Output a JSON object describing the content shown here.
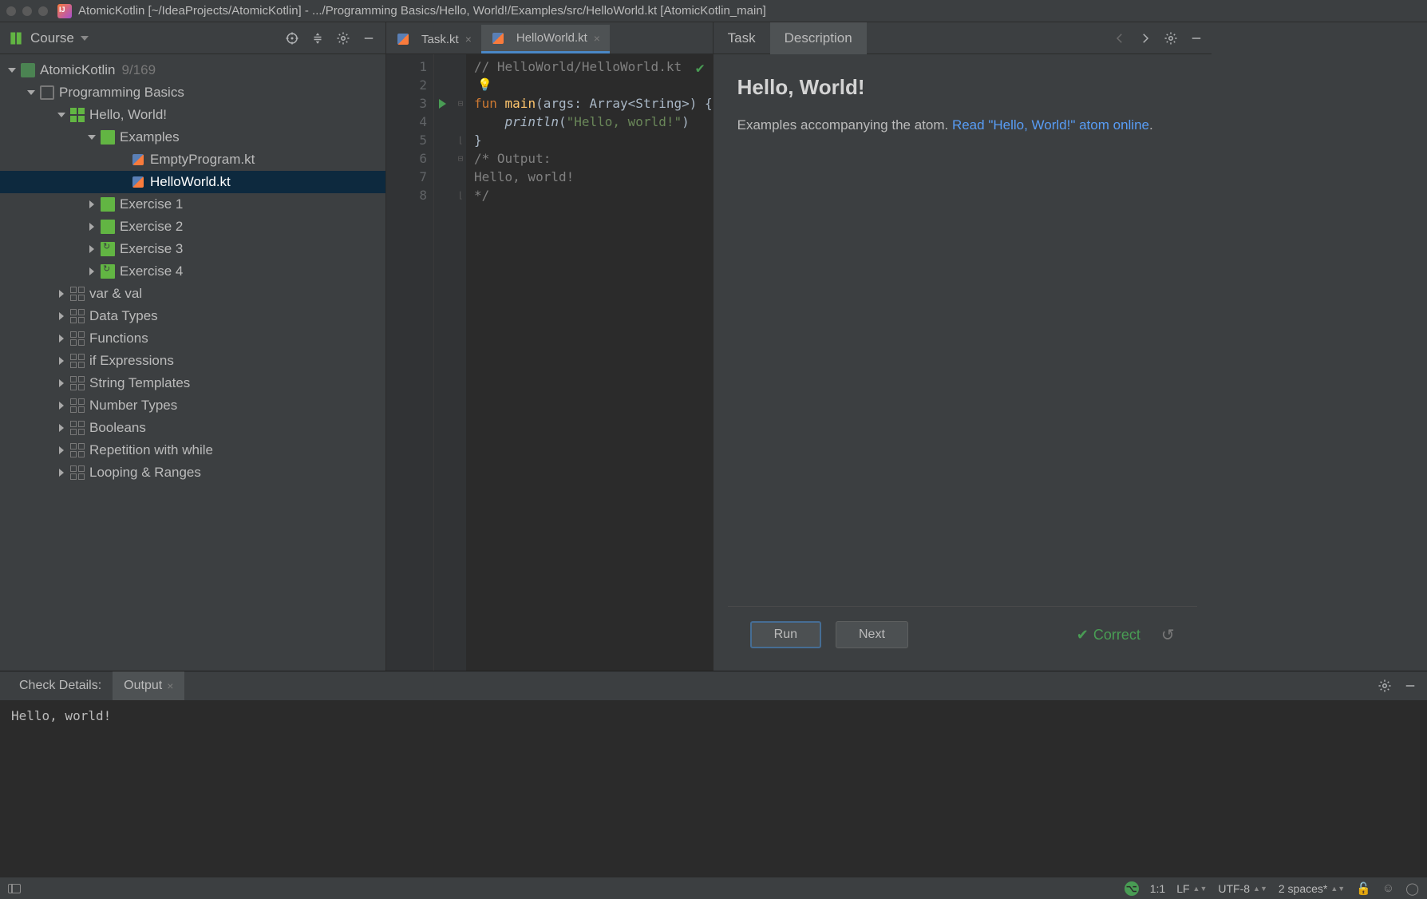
{
  "titlebar": "AtomicKotlin [~/IdeaProjects/AtomicKotlin] - .../Programming Basics/Hello, World!/Examples/src/HelloWorld.kt [AtomicKotlin_main]",
  "sidebar": {
    "header_label": "Course",
    "root": {
      "label": "AtomicKotlin",
      "count": "9/169"
    },
    "module": "Programming Basics",
    "lesson_current": "Hello, World!",
    "examples_label": "Examples",
    "files": [
      "EmptyProgram.kt",
      "HelloWorld.kt"
    ],
    "exercises": [
      "Exercise 1",
      "Exercise 2",
      "Exercise 3",
      "Exercise 4"
    ],
    "lessons": [
      "var & val",
      "Data Types",
      "Functions",
      "if Expressions",
      "String Templates",
      "Number Types",
      "Booleans",
      "Repetition with while",
      "Looping & Ranges"
    ]
  },
  "editor": {
    "tabs": [
      {
        "label": "Task.kt",
        "active": false
      },
      {
        "label": "HelloWorld.kt",
        "active": true
      }
    ],
    "line_numbers": [
      "1",
      "2",
      "3",
      "4",
      "5",
      "6",
      "7",
      "8"
    ],
    "code": {
      "l1_comment": "// HelloWorld/HelloWorld.kt",
      "l3_fun": "fun",
      "l3_main": " main",
      "l3_sig": "(args: Array<String>) {",
      "l4_fn": "println",
      "l4_open": "(",
      "l4_str": "\"Hello, world!\"",
      "l4_close": ")",
      "l5": "}",
      "l6": "/* Output:",
      "l7": "Hello, world!",
      "l8": "*/"
    }
  },
  "task": {
    "tabs": [
      "Task",
      "Description"
    ],
    "title": "Hello, World!",
    "body_prefix": "Examples accompanying the atom. ",
    "body_link": "Read \"Hello, World!\" atom online",
    "body_suffix": ".",
    "run_label": "Run",
    "next_label": "Next",
    "status": "Correct"
  },
  "bottom": {
    "tabs": [
      "Check Details:",
      "Output"
    ],
    "output": "Hello, world!"
  },
  "status": {
    "pos": "1:1",
    "sep": "LF",
    "enc": "UTF-8",
    "indent": "2 spaces*"
  }
}
